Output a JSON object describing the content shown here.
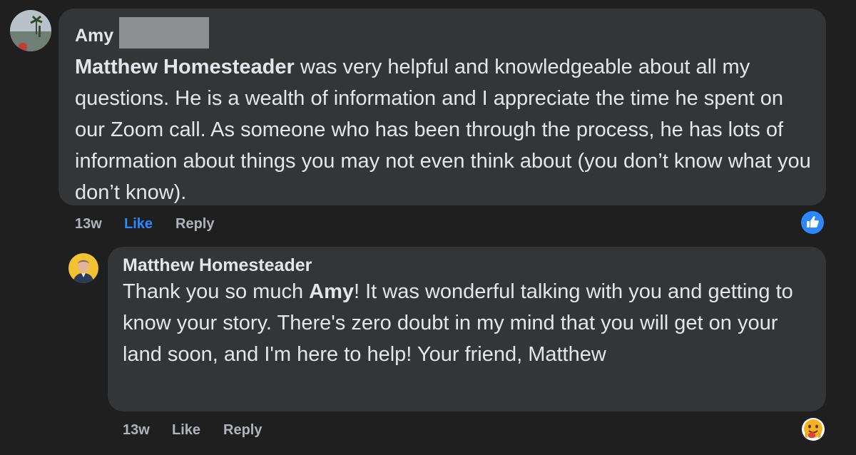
{
  "comment": {
    "author": "Amy",
    "mention": "Matthew Homesteader",
    "text_rest": " was very helpful and knowledgeable about all my questions. He is a wealth of information and I appreciate the time he spent on our Zoom call. As someone who has been through the process, he has lots of information about things you may not even think about (you don’t know what you don’t know).",
    "time": "13w",
    "like_label": "Like",
    "reply_label": "Reply",
    "reaction_icon": "thumbs-up-icon",
    "reaction_color": "#2d88ff"
  },
  "reply": {
    "author": "Matthew Homesteader",
    "text_before": "Thank you so much ",
    "mention": "Amy",
    "text_after": "! It was wonderful talking with you and getting to know your story. There's zero doubt in my mind that you will get on your land soon, and I'm here to help! Your friend, Matthew",
    "time": "13w",
    "like_label": "Like",
    "reply_label": "Reply",
    "reaction_icon": "care-hug-emoji-icon"
  },
  "colors": {
    "background": "#1f1f20",
    "bubble": "#343536",
    "text": "#e4e6eb",
    "meta": "#b0b3b8",
    "accent": "#2d88ff"
  }
}
